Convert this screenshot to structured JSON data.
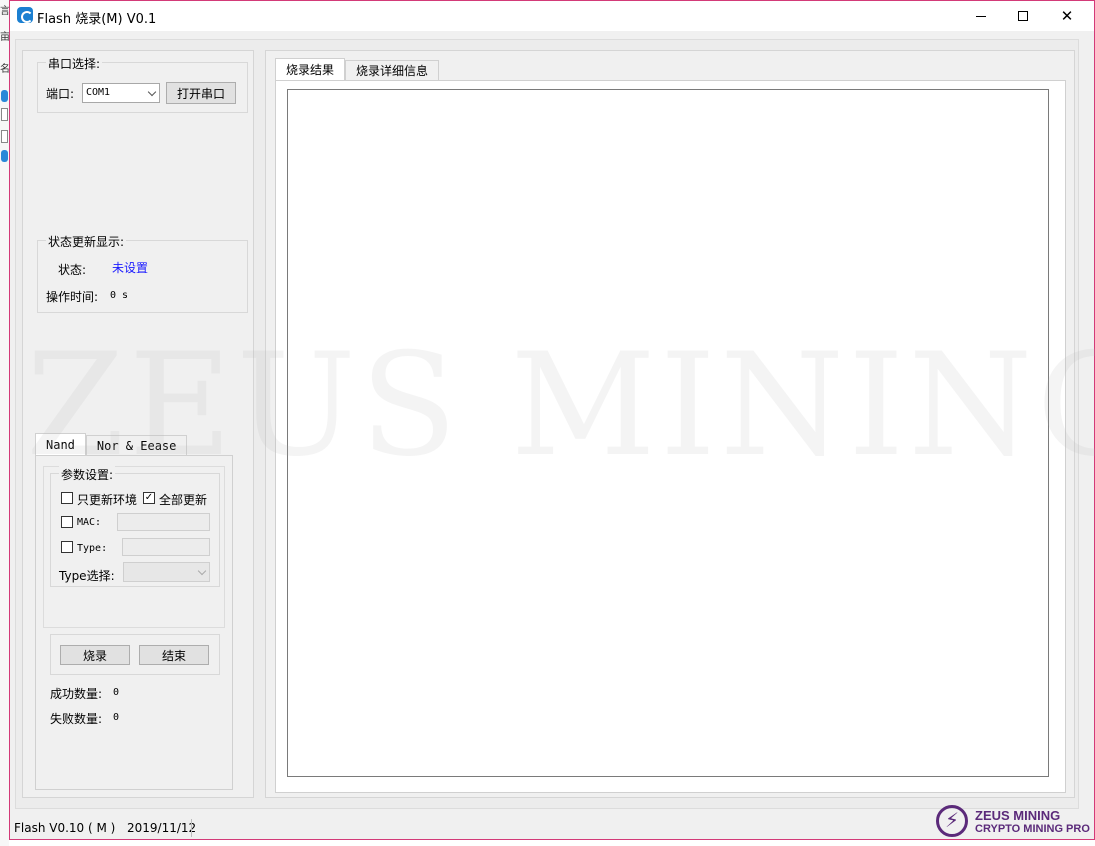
{
  "desktop": {
    "glyph_1": "言",
    "glyph_2": "亩",
    "glyph_3": "名"
  },
  "window": {
    "title": "Flash 烧录(M)  V0.1",
    "minimize_label": "—",
    "maximize_label": "□",
    "close_label": "✕"
  },
  "serial": {
    "group_label": "串口选择:",
    "port_label": "端口:",
    "port_value": "COM1",
    "open_button": "打开串口"
  },
  "status": {
    "group_label": "状态更新显示:",
    "state_label": "状态:",
    "state_value": "未设置",
    "time_label": "操作时间:",
    "time_value": "0 s"
  },
  "nand": {
    "tabs": [
      {
        "label": "Nand"
      },
      {
        "label": "Nor & Eease"
      }
    ],
    "params_label": "参数设置:",
    "only_env_label": "只更新环境",
    "only_env_checked": false,
    "full_update_label": "全部更新",
    "full_update_checked": true,
    "mac_label": "MAC:",
    "mac_value": "",
    "type_label": "Type:",
    "type_value": "",
    "type_select_label": "Type选择:",
    "type_select_value": "",
    "burn_button": "烧录",
    "end_button": "结束",
    "success_label": "成功数量:",
    "success_value": "0",
    "fail_label": "失败数量:",
    "fail_value": "0"
  },
  "result": {
    "tabs": [
      {
        "label": "烧录结果"
      },
      {
        "label": "烧录详细信息"
      }
    ]
  },
  "watermark": "ZEUS MINING",
  "statusbar": {
    "app_version": "Flash  V0.10 ( M )",
    "date": "2019/11/12"
  },
  "logo": {
    "name": "ZEUS MINING",
    "tagline": "CRYPTO MINING PRO"
  },
  "colors": {
    "window_border": "#d33a78",
    "status_value": "#1a1aff",
    "logo": "#5b2a7a"
  }
}
